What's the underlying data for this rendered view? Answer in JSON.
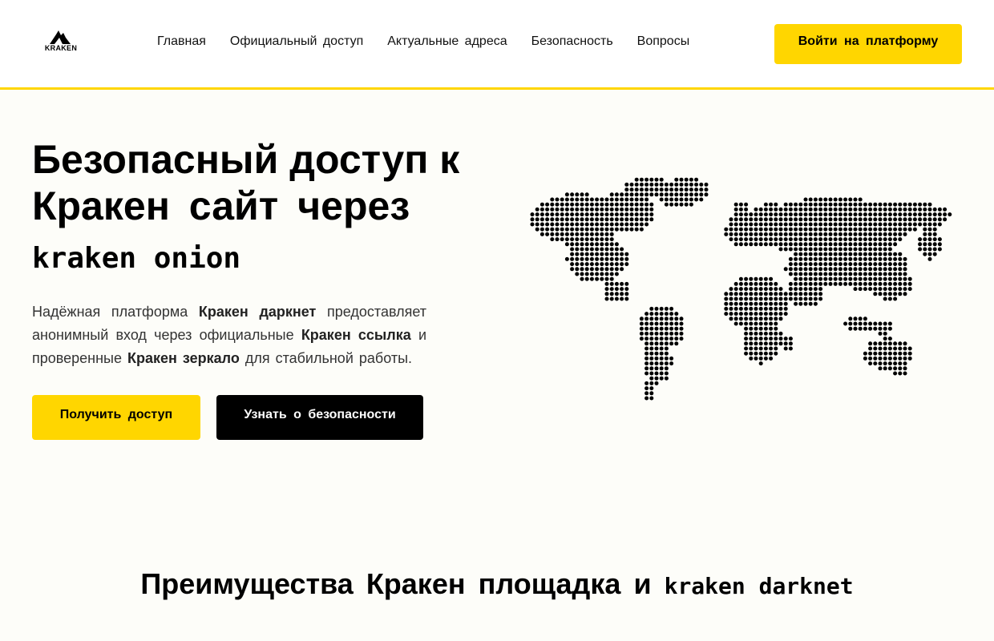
{
  "header": {
    "logo_text": "KRAKEN",
    "nav": [
      "Главная",
      "Официальный доступ",
      "Актуальные адреса",
      "Безопасность",
      "Вопросы"
    ],
    "login_label": "Войти на платформу"
  },
  "hero": {
    "title_line1": "Безопасный доступ к",
    "title_line2": "Кракен сайт через",
    "title_mono": "kraken onion",
    "desc": {
      "p1": "Надёжная платформа ",
      "b1": "Кракен даркнет",
      "p2": " предоставляет анонимный вход через официальные ",
      "b2": "Кракен ссылка",
      "p3": " и проверенные ",
      "b3": "Кракен зеркало",
      "p4": " для стабильной работы."
    },
    "primary_button": "Получить доступ",
    "secondary_button": "Узнать о безопасности"
  },
  "map": {
    "icon": "world-map-dotted",
    "dot_color": "#000000"
  },
  "section": {
    "title": "Преимущества Кракен площадка и ",
    "title_mono": "kraken darknet"
  },
  "colors": {
    "accent": "#ffd600",
    "dark": "#000000",
    "background": "#fdfdf9"
  }
}
